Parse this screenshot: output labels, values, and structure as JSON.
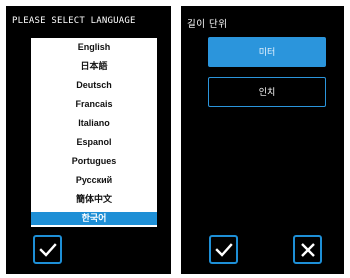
{
  "language_screen": {
    "title": "PLEASE SELECT LANGUAGE",
    "languages": [
      "English",
      "日本語",
      "Deutsch",
      "Francais",
      "Italiano",
      "Espanol",
      "Portugues",
      "Русский",
      "簡体中文",
      "한국어"
    ],
    "selected_index": 9,
    "ok_icon": "checkmark-icon"
  },
  "unit_screen": {
    "title": "길이 단위",
    "options": [
      "미터",
      "인치"
    ],
    "selected_index": 0,
    "ok_icon": "checkmark-icon",
    "cancel_icon": "close-icon"
  },
  "colors": {
    "accent": "#1e8fd6",
    "background": "#000000",
    "list_bg": "#ffffff"
  }
}
